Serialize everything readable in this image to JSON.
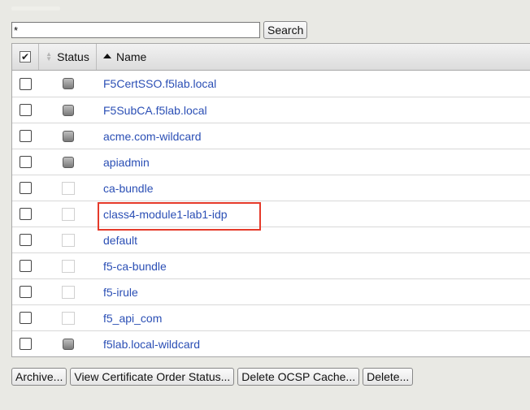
{
  "search": {
    "value": "*",
    "button_label": "Search"
  },
  "table": {
    "headers": {
      "select_all_checked_glyph": "✔",
      "status": "Status",
      "name": "Name"
    },
    "rows": [
      {
        "name": "F5CertSSO.f5lab.local",
        "status": "filled"
      },
      {
        "name": "F5SubCA.f5lab.local",
        "status": "filled"
      },
      {
        "name": "acme.com-wildcard",
        "status": "filled"
      },
      {
        "name": "apiadmin",
        "status": "filled"
      },
      {
        "name": "ca-bundle",
        "status": "empty"
      },
      {
        "name": "class4-module1-lab1-idp",
        "status": "empty"
      },
      {
        "name": "default",
        "status": "empty"
      },
      {
        "name": "f5-ca-bundle",
        "status": "empty"
      },
      {
        "name": "f5-irule",
        "status": "empty"
      },
      {
        "name": "f5_api_com",
        "status": "empty"
      },
      {
        "name": "f5lab.local-wildcard",
        "status": "filled"
      }
    ]
  },
  "actions": {
    "archive": "Archive...",
    "view_order_status": "View Certificate Order Status...",
    "delete_ocsp_cache": "Delete OCSP Cache...",
    "delete": "Delete..."
  },
  "colors": {
    "link": "#2b4fb5",
    "highlight": "#e53a2a"
  }
}
